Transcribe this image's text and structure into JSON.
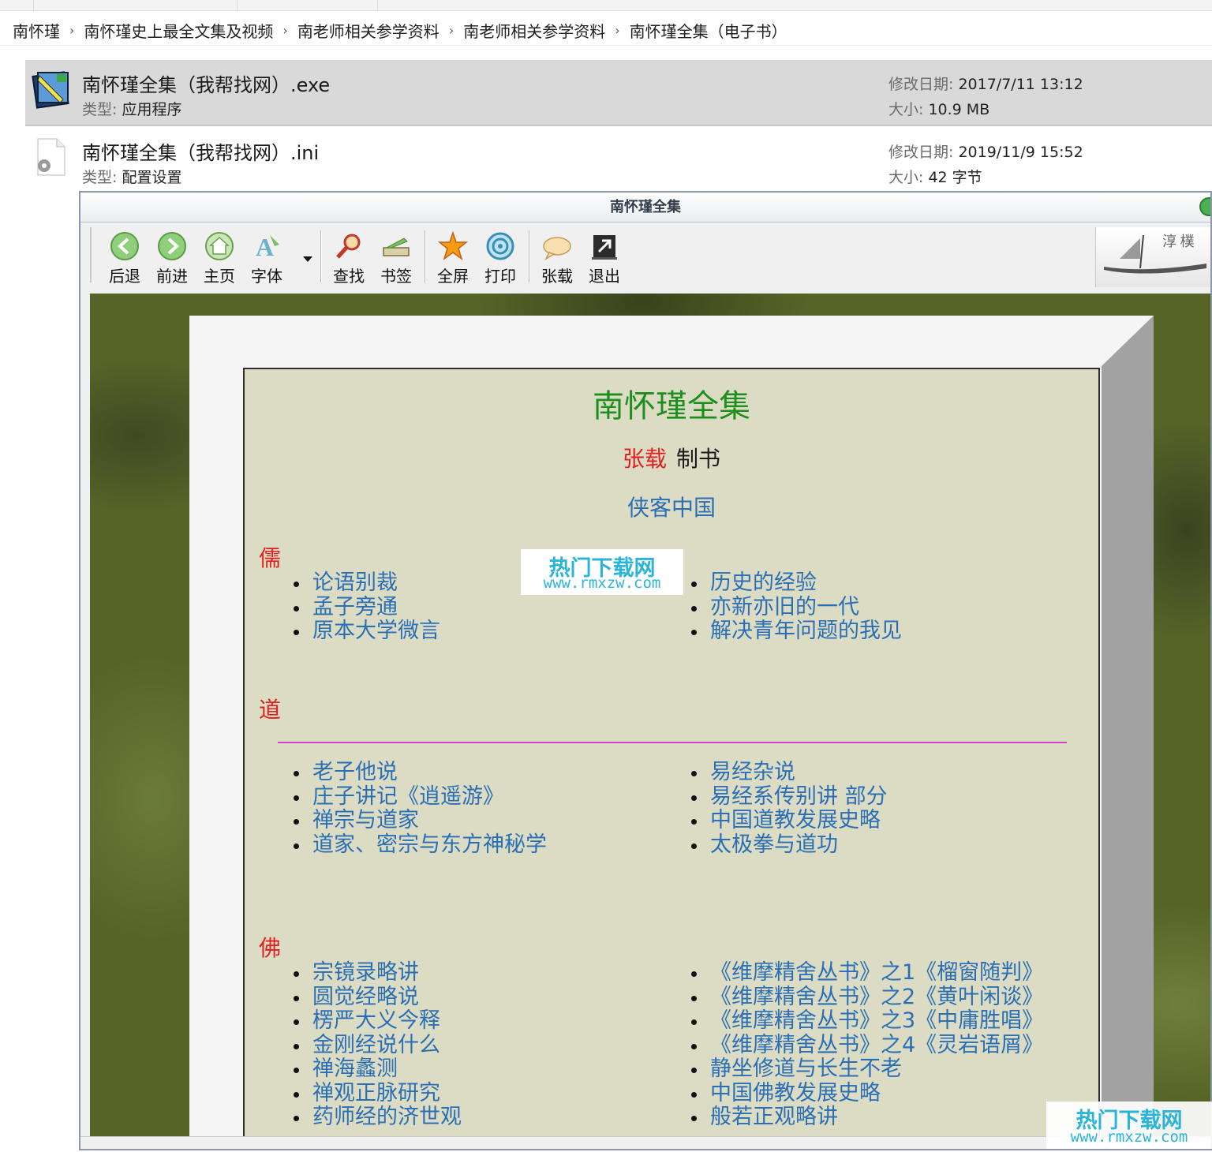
{
  "breadcrumb": [
    "南怀瑾",
    "南怀瑾史上最全文集及视频",
    "南老师相关参学资料",
    "南老师相关参学资料",
    "南怀瑾全集（电子书）"
  ],
  "files": [
    {
      "name": "南怀瑾全集（我帮找网）.exe",
      "type_label": "类型:",
      "type": "应用程序",
      "date_label": "修改日期:",
      "date": "2017/7/11 13:12",
      "size_label": "大小:",
      "size": "10.9 MB",
      "icon": "app-book-icon"
    },
    {
      "name": "南怀瑾全集（我帮找网）.ini",
      "type_label": "类型:",
      "type": "配置设置",
      "date_label": "修改日期:",
      "date": "2019/11/9 15:52",
      "size_label": "大小:",
      "size": "42 字节",
      "icon": "config-file-icon"
    }
  ],
  "app": {
    "title": "南怀瑾全集",
    "toolbar": [
      {
        "label": "后退",
        "icon": "back-arrow-icon"
      },
      {
        "label": "前进",
        "icon": "forward-arrow-icon"
      },
      {
        "label": "主页",
        "icon": "home-icon"
      },
      {
        "label": "字体",
        "icon": "font-icon"
      },
      {
        "label": "查找",
        "icon": "magnifier-icon"
      },
      {
        "label": "书签",
        "icon": "bookmark-icon"
      },
      {
        "label": "全屏",
        "icon": "fullscreen-icon"
      },
      {
        "label": "打印",
        "icon": "print-icon"
      },
      {
        "label": "张载",
        "icon": "speech-bubble-icon"
      },
      {
        "label": "退出",
        "icon": "exit-icon"
      }
    ],
    "banner_text": "淳 樸"
  },
  "doc": {
    "title": "南怀瑾全集",
    "author": "张载",
    "made": "制书",
    "subtitle": "侠客中国",
    "sections": [
      {
        "head": "儒",
        "left": [
          "论语别裁",
          "孟子旁通",
          "原本大学微言"
        ],
        "right": [
          "历史的经验",
          "亦新亦旧的一代",
          "解决青年问题的我见"
        ]
      },
      {
        "head": "道",
        "left": [
          "老子他说",
          "庄子讲记《逍遥游》",
          "禅宗与道家",
          "道家、密宗与东方神秘学"
        ],
        "right": [
          "易经杂说",
          "易经系传别讲  部分",
          "中国道教发展史略",
          "太极拳与道功"
        ]
      },
      {
        "head": "佛",
        "left": [
          "宗镜录略讲",
          "圆觉经略说",
          "楞严大义今释",
          "金刚经说什么",
          "禅海蠡测",
          "禅观正脉研究",
          "药师经的济世观"
        ],
        "right": [
          "《维摩精舍丛书》之1《榴窗随判》",
          "《维摩精舍丛书》之2《黄叶闲谈》",
          "《维摩精舍丛书》之3《中庸胜唱》",
          "《维摩精舍丛书》之4《灵岩语屑》",
          "静坐修道与长生不老",
          "中国佛教发展史略",
          "般若正观略讲"
        ]
      }
    ]
  },
  "watermark": {
    "title": "热门下载网",
    "url": "www.rmxzw.com"
  },
  "colors": {
    "selected_row": "#d9d9d9",
    "doc_bg": "#dcdcc4",
    "link": "#2a6fb5",
    "section_head": "#e02020",
    "title_green": "#1e8f1e",
    "divider": "#d040c8"
  }
}
